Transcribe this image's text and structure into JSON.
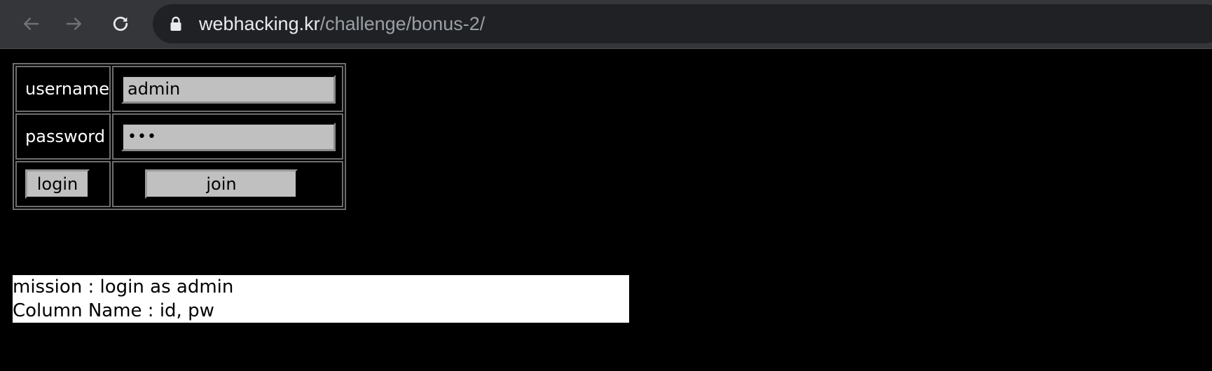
{
  "browser": {
    "back_icon": "arrow-left-icon",
    "forward_icon": "arrow-right-icon",
    "reload_icon": "reload-icon",
    "lock_icon": "lock-icon",
    "url_host": "webhacking.kr",
    "url_path": "/challenge/bonus-2/"
  },
  "form": {
    "username_label": "username",
    "username_value": "admin",
    "password_label": "password",
    "password_masked": "•••",
    "login_label": "login",
    "join_label": "join"
  },
  "mission": {
    "line1": "mission : login as admin",
    "line2": "Column Name : id, pw"
  },
  "colors": {
    "page_bg": "#000000",
    "chrome_bg": "#35363a",
    "omnibox_bg": "#202124",
    "field_bg": "#c0c0c0",
    "mission_bg": "#ffffff"
  }
}
